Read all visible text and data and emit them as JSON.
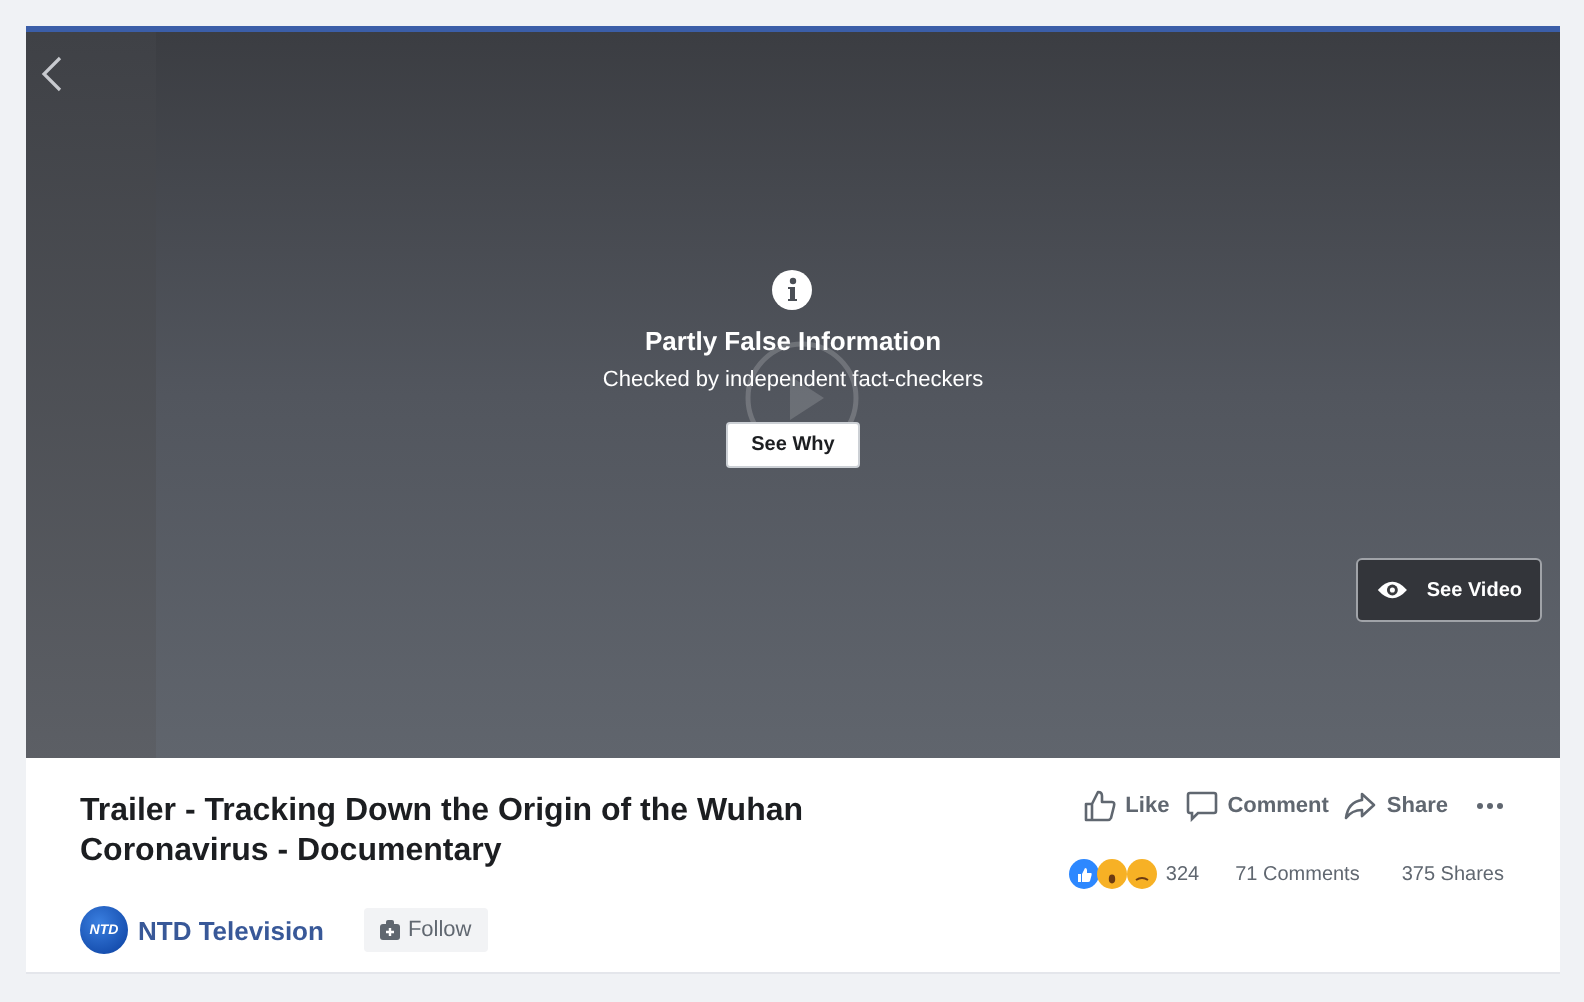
{
  "video": {
    "warning": {
      "title": "Partly False Information",
      "subtitle": "Checked by independent fact-checkers",
      "button": "See Why"
    },
    "see_video": "See Video"
  },
  "post": {
    "title": "Trailer - Tracking Down the Origin of the Wuhan Coronavirus - Documentary",
    "page": {
      "avatar_text": "NTD",
      "name": "NTD Television",
      "follow": "Follow"
    },
    "actions": [
      {
        "kind": "like",
        "label": "Like"
      },
      {
        "kind": "comment",
        "label": "Comment"
      },
      {
        "kind": "share",
        "label": "Share"
      },
      {
        "kind": "more"
      }
    ],
    "reactions_count": "324",
    "comments": "71 Comments",
    "shares": "375 Shares"
  }
}
